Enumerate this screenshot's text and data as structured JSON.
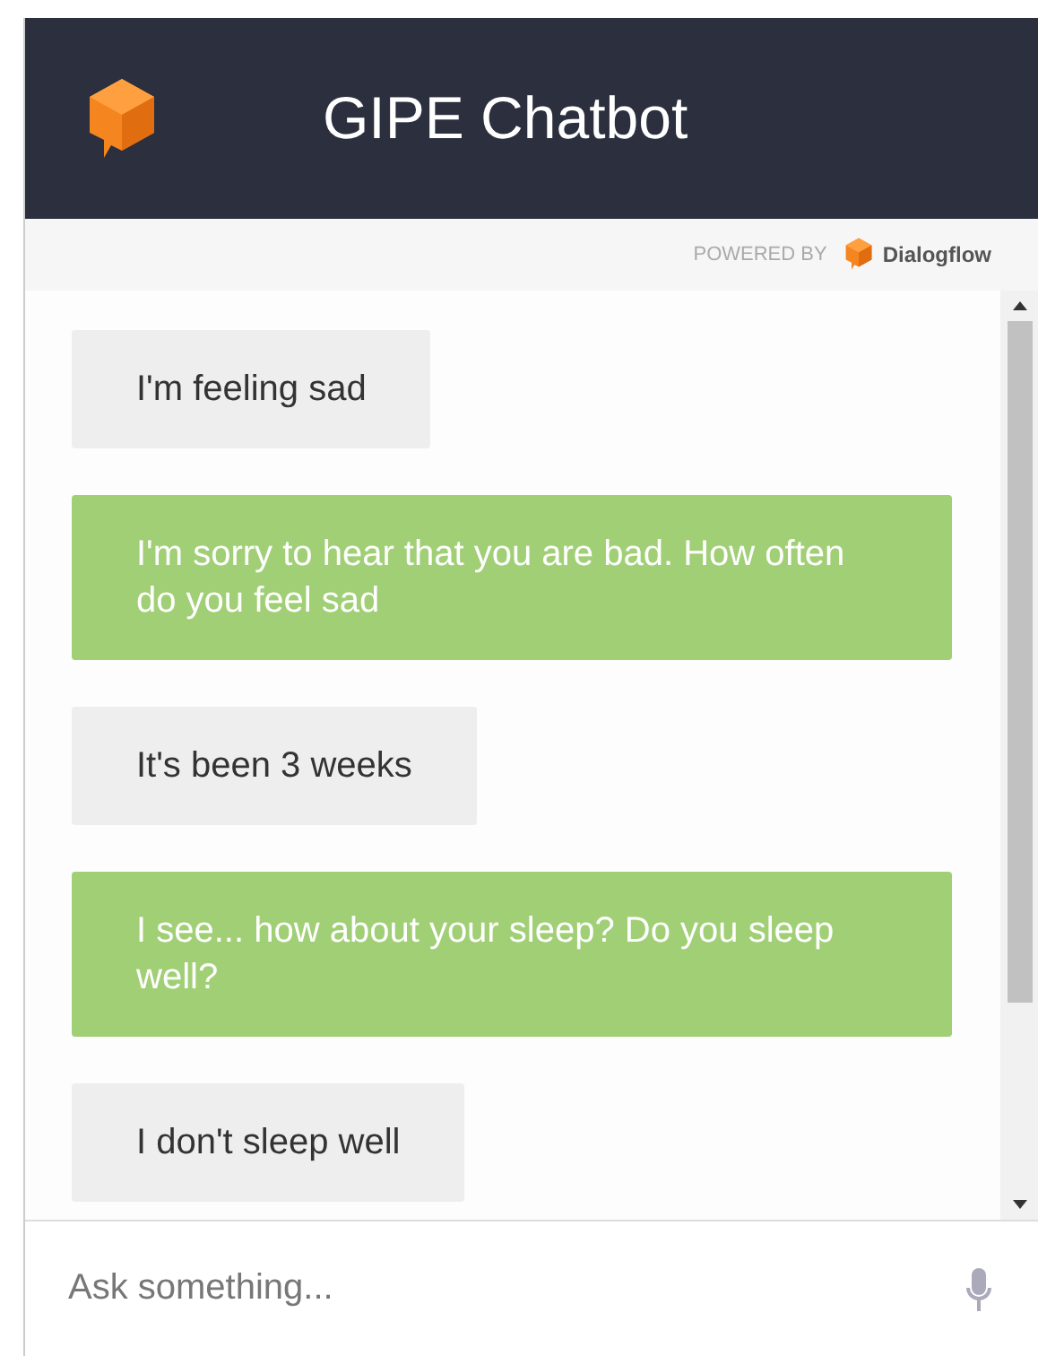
{
  "header": {
    "title": "GIPE Chatbot"
  },
  "powered_by": {
    "label": "POWERED BY",
    "brand": "Dialogflow"
  },
  "messages": [
    {
      "kind": "user",
      "text": "I'm feeling sad"
    },
    {
      "kind": "bot",
      "text": "I'm sorry to hear that you are bad. How often do you feel sad"
    },
    {
      "kind": "user",
      "text": "It's been 3 weeks"
    },
    {
      "kind": "bot",
      "text": "I see... how about your sleep? Do you sleep well?"
    },
    {
      "kind": "user",
      "text": "I don't sleep well"
    }
  ],
  "input": {
    "placeholder": "Ask something..."
  }
}
